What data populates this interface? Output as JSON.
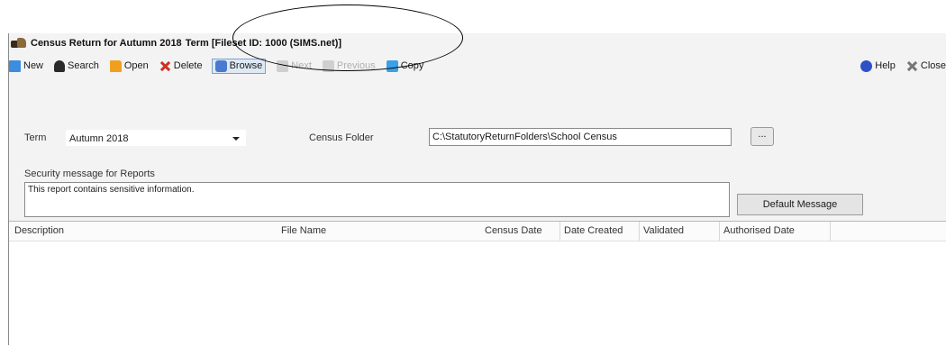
{
  "window": {
    "title_part1": "Census Return for Autumn 2018",
    "title_part2": "Term [Fileset ID: 1000 (SIMS.net)]"
  },
  "toolbar": {
    "new": "New",
    "search": "Search",
    "open": "Open",
    "delete": "Delete",
    "browse": "Browse",
    "next": "Next",
    "previous": "Previous",
    "copy": "Copy",
    "help": "Help",
    "close": "Close"
  },
  "form": {
    "term_label": "Term",
    "term_value": "Autumn 2018",
    "census_folder_label": "Census Folder",
    "census_folder_value": "C:\\StatutoryReturnFolders\\School Census",
    "browse_folder_button": "...",
    "security_label": "Security message for Reports",
    "security_message": "This report contains sensitive information.",
    "default_message_button": "Default Message"
  },
  "grid": {
    "columns": [
      "Description",
      "File Name",
      "Census Date",
      "Date Created",
      "Validated",
      "Authorised Date"
    ],
    "rows": []
  },
  "icons": {
    "app": "sims-logo-icon",
    "new": "new-document-icon",
    "search": "binoculars-icon",
    "open": "folder-open-icon",
    "delete": "delete-x-icon",
    "browse": "browse-icon",
    "copy": "copy-icon",
    "help": "help-globe-icon",
    "close": "close-x-icon"
  }
}
